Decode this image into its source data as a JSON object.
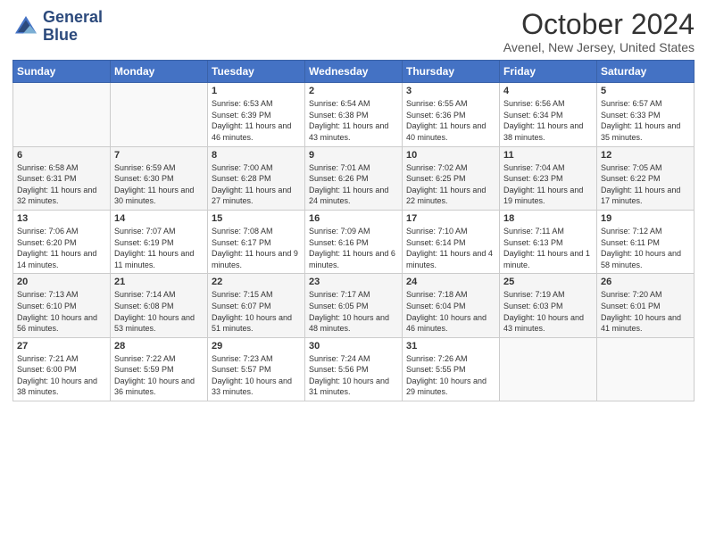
{
  "logo": {
    "line1": "General",
    "line2": "Blue"
  },
  "title": "October 2024",
  "location": "Avenel, New Jersey, United States",
  "weekdays": [
    "Sunday",
    "Monday",
    "Tuesday",
    "Wednesday",
    "Thursday",
    "Friday",
    "Saturday"
  ],
  "weeks": [
    [
      {
        "day": "",
        "info": ""
      },
      {
        "day": "",
        "info": ""
      },
      {
        "day": "1",
        "info": "Sunrise: 6:53 AM\nSunset: 6:39 PM\nDaylight: 11 hours and 46 minutes."
      },
      {
        "day": "2",
        "info": "Sunrise: 6:54 AM\nSunset: 6:38 PM\nDaylight: 11 hours and 43 minutes."
      },
      {
        "day": "3",
        "info": "Sunrise: 6:55 AM\nSunset: 6:36 PM\nDaylight: 11 hours and 40 minutes."
      },
      {
        "day": "4",
        "info": "Sunrise: 6:56 AM\nSunset: 6:34 PM\nDaylight: 11 hours and 38 minutes."
      },
      {
        "day": "5",
        "info": "Sunrise: 6:57 AM\nSunset: 6:33 PM\nDaylight: 11 hours and 35 minutes."
      }
    ],
    [
      {
        "day": "6",
        "info": "Sunrise: 6:58 AM\nSunset: 6:31 PM\nDaylight: 11 hours and 32 minutes."
      },
      {
        "day": "7",
        "info": "Sunrise: 6:59 AM\nSunset: 6:30 PM\nDaylight: 11 hours and 30 minutes."
      },
      {
        "day": "8",
        "info": "Sunrise: 7:00 AM\nSunset: 6:28 PM\nDaylight: 11 hours and 27 minutes."
      },
      {
        "day": "9",
        "info": "Sunrise: 7:01 AM\nSunset: 6:26 PM\nDaylight: 11 hours and 24 minutes."
      },
      {
        "day": "10",
        "info": "Sunrise: 7:02 AM\nSunset: 6:25 PM\nDaylight: 11 hours and 22 minutes."
      },
      {
        "day": "11",
        "info": "Sunrise: 7:04 AM\nSunset: 6:23 PM\nDaylight: 11 hours and 19 minutes."
      },
      {
        "day": "12",
        "info": "Sunrise: 7:05 AM\nSunset: 6:22 PM\nDaylight: 11 hours and 17 minutes."
      }
    ],
    [
      {
        "day": "13",
        "info": "Sunrise: 7:06 AM\nSunset: 6:20 PM\nDaylight: 11 hours and 14 minutes."
      },
      {
        "day": "14",
        "info": "Sunrise: 7:07 AM\nSunset: 6:19 PM\nDaylight: 11 hours and 11 minutes."
      },
      {
        "day": "15",
        "info": "Sunrise: 7:08 AM\nSunset: 6:17 PM\nDaylight: 11 hours and 9 minutes."
      },
      {
        "day": "16",
        "info": "Sunrise: 7:09 AM\nSunset: 6:16 PM\nDaylight: 11 hours and 6 minutes."
      },
      {
        "day": "17",
        "info": "Sunrise: 7:10 AM\nSunset: 6:14 PM\nDaylight: 11 hours and 4 minutes."
      },
      {
        "day": "18",
        "info": "Sunrise: 7:11 AM\nSunset: 6:13 PM\nDaylight: 11 hours and 1 minute."
      },
      {
        "day": "19",
        "info": "Sunrise: 7:12 AM\nSunset: 6:11 PM\nDaylight: 10 hours and 58 minutes."
      }
    ],
    [
      {
        "day": "20",
        "info": "Sunrise: 7:13 AM\nSunset: 6:10 PM\nDaylight: 10 hours and 56 minutes."
      },
      {
        "day": "21",
        "info": "Sunrise: 7:14 AM\nSunset: 6:08 PM\nDaylight: 10 hours and 53 minutes."
      },
      {
        "day": "22",
        "info": "Sunrise: 7:15 AM\nSunset: 6:07 PM\nDaylight: 10 hours and 51 minutes."
      },
      {
        "day": "23",
        "info": "Sunrise: 7:17 AM\nSunset: 6:05 PM\nDaylight: 10 hours and 48 minutes."
      },
      {
        "day": "24",
        "info": "Sunrise: 7:18 AM\nSunset: 6:04 PM\nDaylight: 10 hours and 46 minutes."
      },
      {
        "day": "25",
        "info": "Sunrise: 7:19 AM\nSunset: 6:03 PM\nDaylight: 10 hours and 43 minutes."
      },
      {
        "day": "26",
        "info": "Sunrise: 7:20 AM\nSunset: 6:01 PM\nDaylight: 10 hours and 41 minutes."
      }
    ],
    [
      {
        "day": "27",
        "info": "Sunrise: 7:21 AM\nSunset: 6:00 PM\nDaylight: 10 hours and 38 minutes."
      },
      {
        "day": "28",
        "info": "Sunrise: 7:22 AM\nSunset: 5:59 PM\nDaylight: 10 hours and 36 minutes."
      },
      {
        "day": "29",
        "info": "Sunrise: 7:23 AM\nSunset: 5:57 PM\nDaylight: 10 hours and 33 minutes."
      },
      {
        "day": "30",
        "info": "Sunrise: 7:24 AM\nSunset: 5:56 PM\nDaylight: 10 hours and 31 minutes."
      },
      {
        "day": "31",
        "info": "Sunrise: 7:26 AM\nSunset: 5:55 PM\nDaylight: 10 hours and 29 minutes."
      },
      {
        "day": "",
        "info": ""
      },
      {
        "day": "",
        "info": ""
      }
    ]
  ]
}
